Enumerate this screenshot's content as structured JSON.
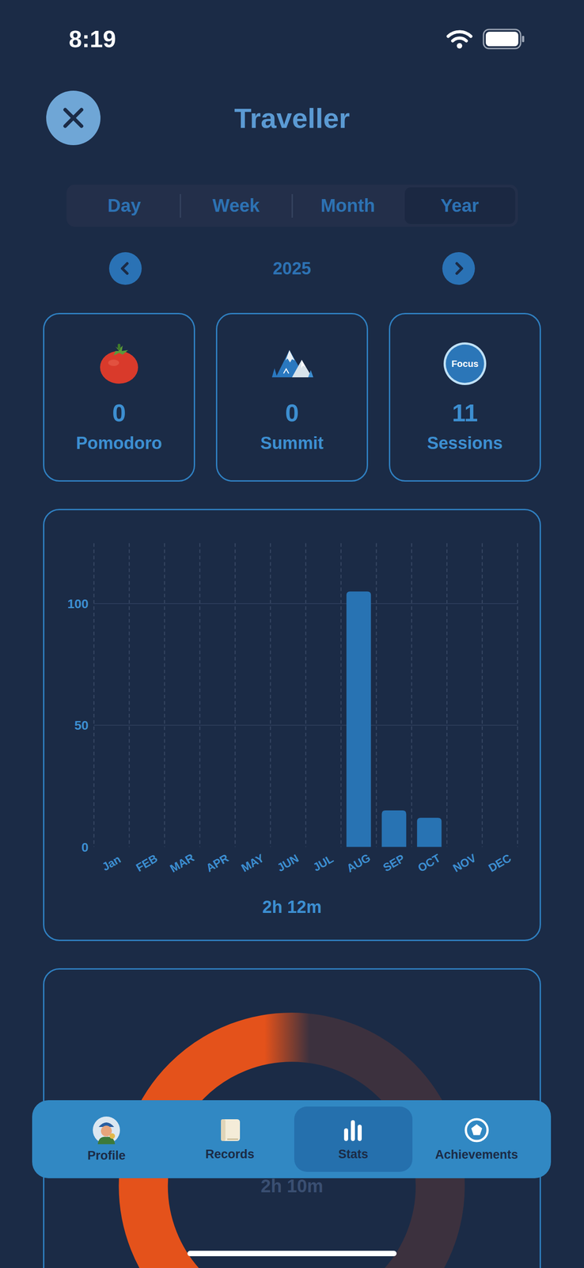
{
  "status_bar": {
    "time": "8:19"
  },
  "header": {
    "title": "Traveller"
  },
  "period_tabs": [
    {
      "label": "Day",
      "selected": false
    },
    {
      "label": "Week",
      "selected": false
    },
    {
      "label": "Month",
      "selected": false
    },
    {
      "label": "Year",
      "selected": true
    }
  ],
  "period": {
    "label": "2025"
  },
  "stats": [
    {
      "kind": "pomodoro",
      "value": "0",
      "label": "Pomodoro"
    },
    {
      "kind": "summit",
      "value": "0",
      "label": "Summit"
    },
    {
      "kind": "sessions",
      "badge": "Focus",
      "value": "11",
      "label": "Sessions"
    }
  ],
  "bar_chart": {
    "y_ticks": [
      "100",
      "50",
      "0"
    ],
    "x_labels": [
      "Jan",
      "FEB",
      "MAR",
      "APR",
      "MAY",
      "JUN",
      "JUL",
      "AUG",
      "SEP",
      "OCT",
      "NOV",
      "DEC"
    ],
    "values": [
      0,
      0,
      0,
      0,
      0,
      0,
      0,
      105,
      15,
      12,
      0,
      0
    ],
    "total": "2h 12m"
  },
  "donut_chart": {
    "total": "2h 10m",
    "segments": [
      {
        "value": 130,
        "color": "#e4521b"
      }
    ]
  },
  "nav": [
    {
      "kind": "profile",
      "label": "Profile",
      "selected": false
    },
    {
      "kind": "records",
      "label": "Records",
      "selected": false
    },
    {
      "kind": "stats",
      "label": "Stats",
      "selected": true
    },
    {
      "kind": "achievements",
      "label": "Achievements",
      "selected": false
    }
  ]
}
